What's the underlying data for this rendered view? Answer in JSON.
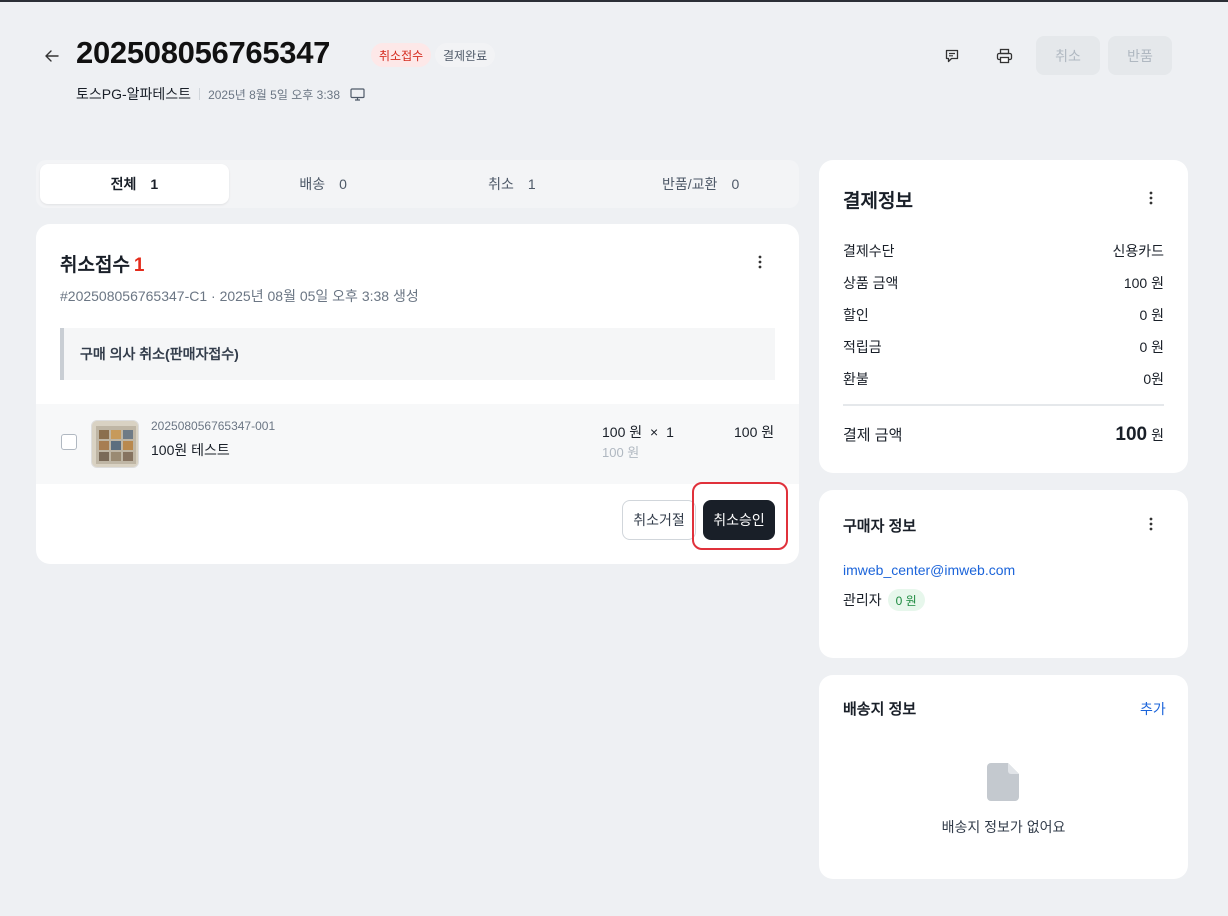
{
  "header": {
    "order_number": "202508056765347",
    "badges": [
      "취소접수",
      "결제완료"
    ],
    "shop_name": "토스PG-알파테스트",
    "order_datetime": "2025년 8월 5일 오후 3:38",
    "buttons": {
      "cancel": "취소",
      "return": "반품"
    }
  },
  "tabs": [
    {
      "label": "전체",
      "count": "1"
    },
    {
      "label": "배송",
      "count": "0"
    },
    {
      "label": "취소",
      "count": "1"
    },
    {
      "label": "반품/교환",
      "count": "0"
    }
  ],
  "cancel_section": {
    "title": "취소접수",
    "count": "1",
    "meta": "#202508056765347-C1 · 2025년 08월 05일 오후 3:38 생성",
    "reason": "구매 의사 취소(판매자접수)",
    "item": {
      "code": "202508056765347-001",
      "name": "100원 테스트",
      "unit_price": "100 원",
      "multiply": "×",
      "quantity": "1",
      "unit_price_sub": "100 원",
      "line_total": "100 원"
    },
    "buttons": {
      "reject": "취소거절",
      "approve": "취소승인"
    }
  },
  "payment_info": {
    "title": "결제정보",
    "rows": [
      {
        "label": "결제수단",
        "value": "신용카드"
      },
      {
        "label": "상품 금액",
        "value": "100 원"
      },
      {
        "label": "할인",
        "value": "0 원"
      },
      {
        "label": "적립금",
        "value": "0 원"
      },
      {
        "label": "환불",
        "value": "0원"
      }
    ],
    "total_label": "결제 금액",
    "total_value": "100",
    "total_unit": "원"
  },
  "buyer_info": {
    "title": "구매자 정보",
    "email": "imweb_center@imweb.com",
    "role": "관리자",
    "points": "0 원"
  },
  "shipping_info": {
    "title": "배송지 정보",
    "add_label": "추가",
    "empty_text": "배송지 정보가 없어요"
  }
}
